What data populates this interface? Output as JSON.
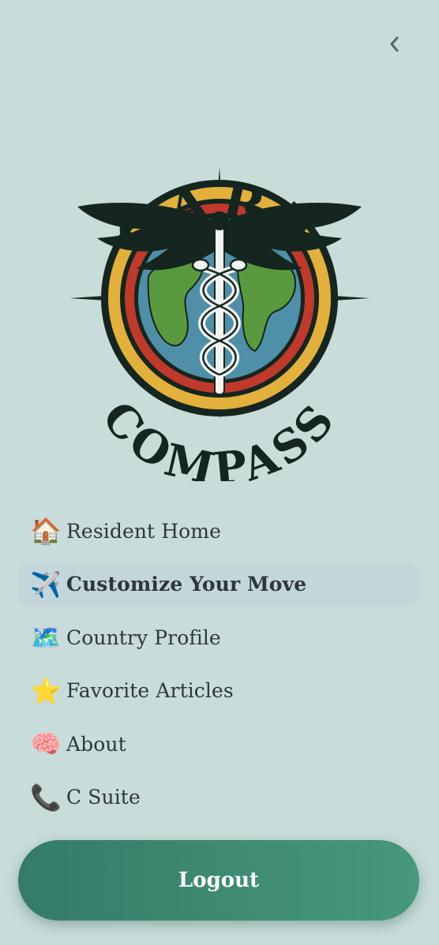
{
  "header": {
    "back_icon": "chevron-left-icon"
  },
  "logo": {
    "top_text": "CARE",
    "bottom_text": "COMPASS",
    "colors": {
      "dark": "#14261f",
      "gold": "#e3b03c",
      "red": "#c0392b",
      "ocean": "#4f8fa8",
      "land": "#5a9a3f"
    }
  },
  "nav": {
    "items": [
      {
        "icon": "🏠",
        "icon_name": "house-icon",
        "label": "Resident Home",
        "active": false
      },
      {
        "icon": "✈️",
        "icon_name": "airplane-icon",
        "label": "Customize Your Move",
        "active": true
      },
      {
        "icon": "🗺️",
        "icon_name": "map-icon",
        "label": "Country Profile",
        "active": false
      },
      {
        "icon": "⭐",
        "icon_name": "star-icon",
        "label": "Favorite Articles",
        "active": false
      },
      {
        "icon": "🧠",
        "icon_name": "brain-icon",
        "label": "About",
        "active": false
      },
      {
        "icon": "📞",
        "icon_name": "phone-icon",
        "label": "C Suite",
        "active": false
      }
    ]
  },
  "logout": {
    "label": "Logout"
  },
  "theme": {
    "background": "#c8dcd9",
    "active_item_bg": "#c3d6da",
    "button_gradient_start": "#357b68",
    "button_gradient_end": "#47987c"
  }
}
